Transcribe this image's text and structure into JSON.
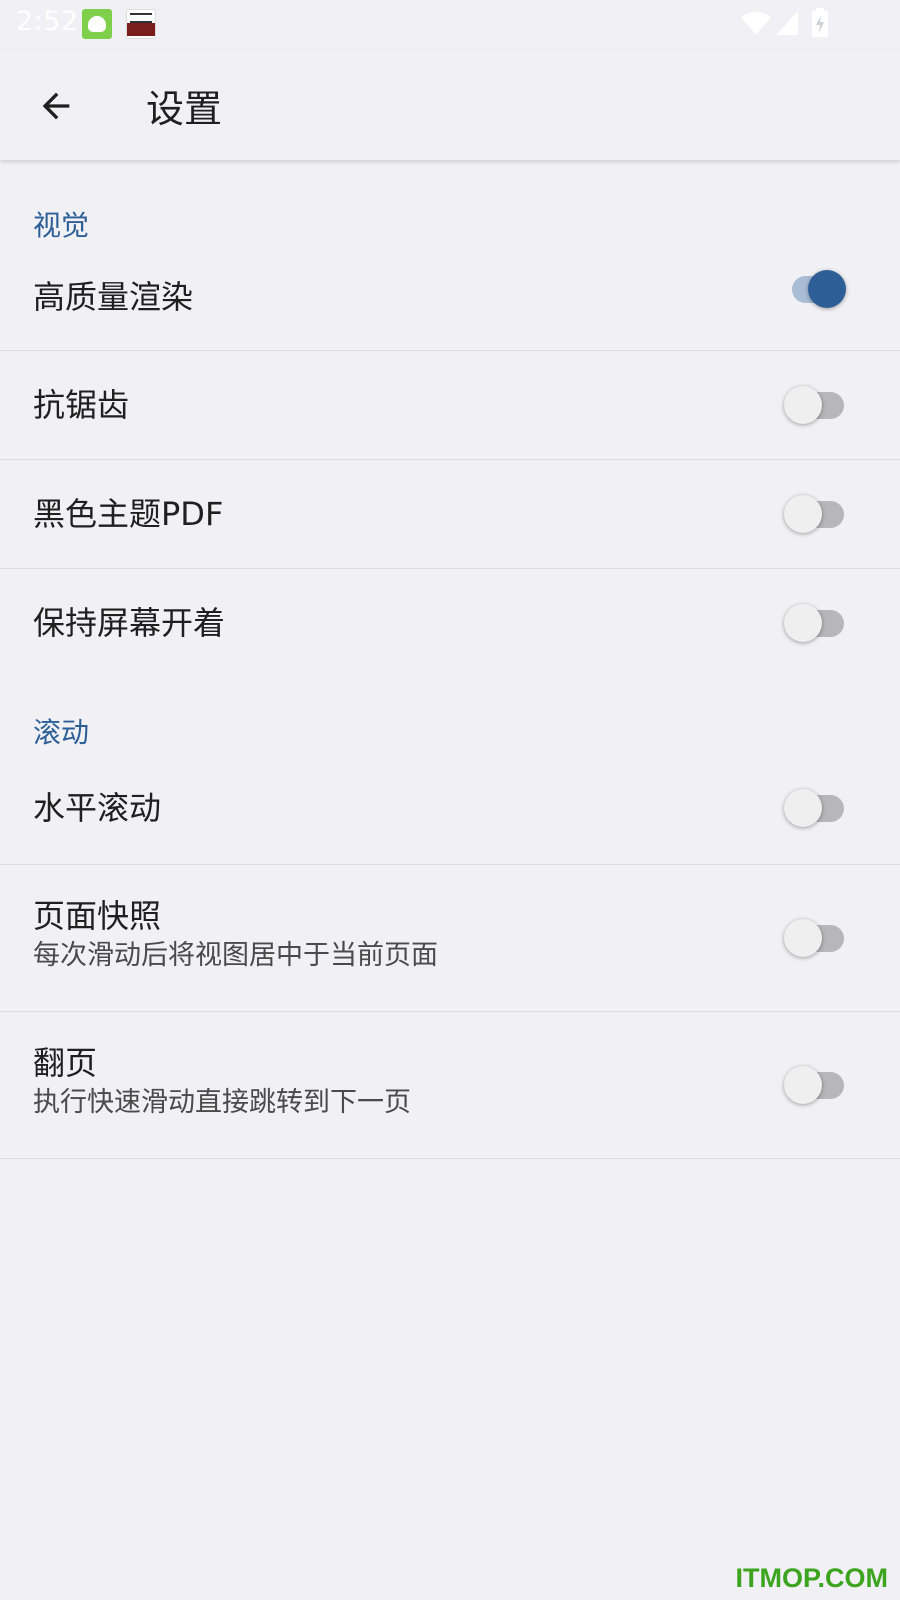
{
  "status_bar": {
    "time": "2:52",
    "notification_icons": [
      "app-mascot-icon",
      "news-app-icon"
    ],
    "system_icons": [
      "wifi-icon",
      "cell-signal-icon",
      "battery-charging-icon"
    ]
  },
  "app_bar": {
    "title": "设置",
    "back_icon": "arrow-back-icon"
  },
  "sections": [
    {
      "header": "视觉",
      "items": [
        {
          "title": "高质量渲染",
          "checked": true
        },
        {
          "title": "抗锯齿",
          "checked": false
        },
        {
          "title": "黑色主题PDF",
          "checked": false
        },
        {
          "title": "保持屏幕开着",
          "checked": false
        }
      ]
    },
    {
      "header": "滚动",
      "items": [
        {
          "title": "水平滚动",
          "checked": false
        },
        {
          "title": "页面快照",
          "subtitle": "每次滑动后将视图居中于当前页面",
          "checked": false
        },
        {
          "title": "翻页",
          "subtitle": "执行快速滑动直接跳转到下一页",
          "checked": false
        }
      ]
    }
  ],
  "watermark": "ITMOP.COM",
  "colors": {
    "background": "#f0f0f5",
    "accent": "#2d5f96",
    "switch_track_on": "#a9bdd6",
    "switch_track_off": "#b6b6bb",
    "watermark": "#3da41f"
  }
}
